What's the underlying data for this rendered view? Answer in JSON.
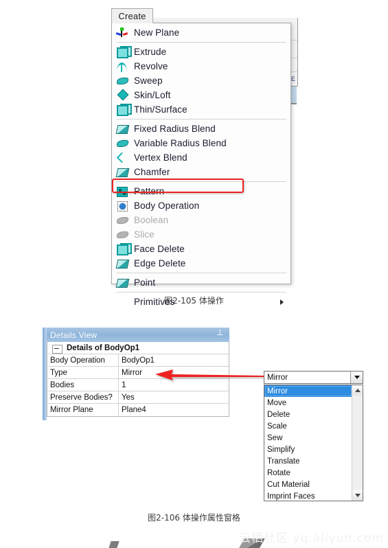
{
  "background_window": {
    "e_glyph": "E"
  },
  "create_menu": {
    "tab_label": "Create",
    "groups": [
      {
        "items": [
          {
            "label": "New Plane",
            "icon": "new-plane-icon",
            "disabled": false,
            "submenu": false
          }
        ]
      },
      {
        "items": [
          {
            "label": "Extrude",
            "icon": "extrude-icon",
            "disabled": false,
            "submenu": false
          },
          {
            "label": "Revolve",
            "icon": "revolve-icon",
            "disabled": false,
            "submenu": false
          },
          {
            "label": "Sweep",
            "icon": "sweep-icon",
            "disabled": false,
            "submenu": false
          },
          {
            "label": "Skin/Loft",
            "icon": "skin-loft-icon",
            "disabled": false,
            "submenu": false
          },
          {
            "label": "Thin/Surface",
            "icon": "thin-surface-icon",
            "disabled": false,
            "submenu": false
          }
        ]
      },
      {
        "items": [
          {
            "label": "Fixed Radius Blend",
            "icon": "fixed-radius-blend-icon",
            "disabled": false,
            "submenu": false
          },
          {
            "label": "Variable Radius Blend",
            "icon": "variable-radius-blend-icon",
            "disabled": false,
            "submenu": false
          },
          {
            "label": "Vertex Blend",
            "icon": "vertex-blend-icon",
            "disabled": false,
            "submenu": false
          },
          {
            "label": "Chamfer",
            "icon": "chamfer-icon",
            "disabled": false,
            "submenu": false
          }
        ]
      },
      {
        "items": [
          {
            "label": "Pattern",
            "icon": "pattern-icon",
            "disabled": false,
            "submenu": false
          },
          {
            "label": "Body Operation",
            "icon": "body-operation-icon",
            "disabled": false,
            "submenu": false,
            "highlighted": true
          },
          {
            "label": "Boolean",
            "icon": "boolean-icon",
            "disabled": true,
            "submenu": false
          },
          {
            "label": "Slice",
            "icon": "slice-icon",
            "disabled": true,
            "submenu": false
          },
          {
            "label": "Face Delete",
            "icon": "face-delete-icon",
            "disabled": false,
            "submenu": false
          },
          {
            "label": "Edge Delete",
            "icon": "edge-delete-icon",
            "disabled": false,
            "submenu": false
          }
        ]
      },
      {
        "items": [
          {
            "label": "Point",
            "icon": "point-icon",
            "disabled": false,
            "submenu": false
          }
        ]
      },
      {
        "items": [
          {
            "label": "Primitives",
            "icon": "",
            "disabled": false,
            "submenu": true
          }
        ]
      }
    ],
    "highlight_color": "#ee2222"
  },
  "captions": {
    "figure_1": "图2-105 体操作",
    "figure_2": "图2-106 体操作属性窗格"
  },
  "details_view": {
    "title": "Details View",
    "pin_icon": "pin-icon",
    "section_header": "Details of BodyOp1",
    "rows": [
      {
        "key": "Body Operation",
        "value": "BodyOp1"
      },
      {
        "key": "Type",
        "value": "Mirror"
      },
      {
        "key": "Bodies",
        "value": "1"
      },
      {
        "key": "Preserve Bodies?",
        "value": "Yes"
      },
      {
        "key": "Mirror Plane",
        "value": "Plane4"
      }
    ],
    "title_bar_color": "#8eb4da"
  },
  "type_dropdown": {
    "selected_value": "Mirror",
    "options": [
      "Mirror",
      "Move",
      "Delete",
      "Scale",
      "Sew",
      "Simplify",
      "Translate",
      "Rotate",
      "Cut Material",
      "Imprint Faces"
    ],
    "selected_index": 0,
    "highlight_color": "#2d8ce0"
  },
  "annotation": {
    "arrow_color": "#ee2222"
  },
  "watermark": {
    "cn": "云栖社区",
    "en": "yq.aliyun.com"
  }
}
